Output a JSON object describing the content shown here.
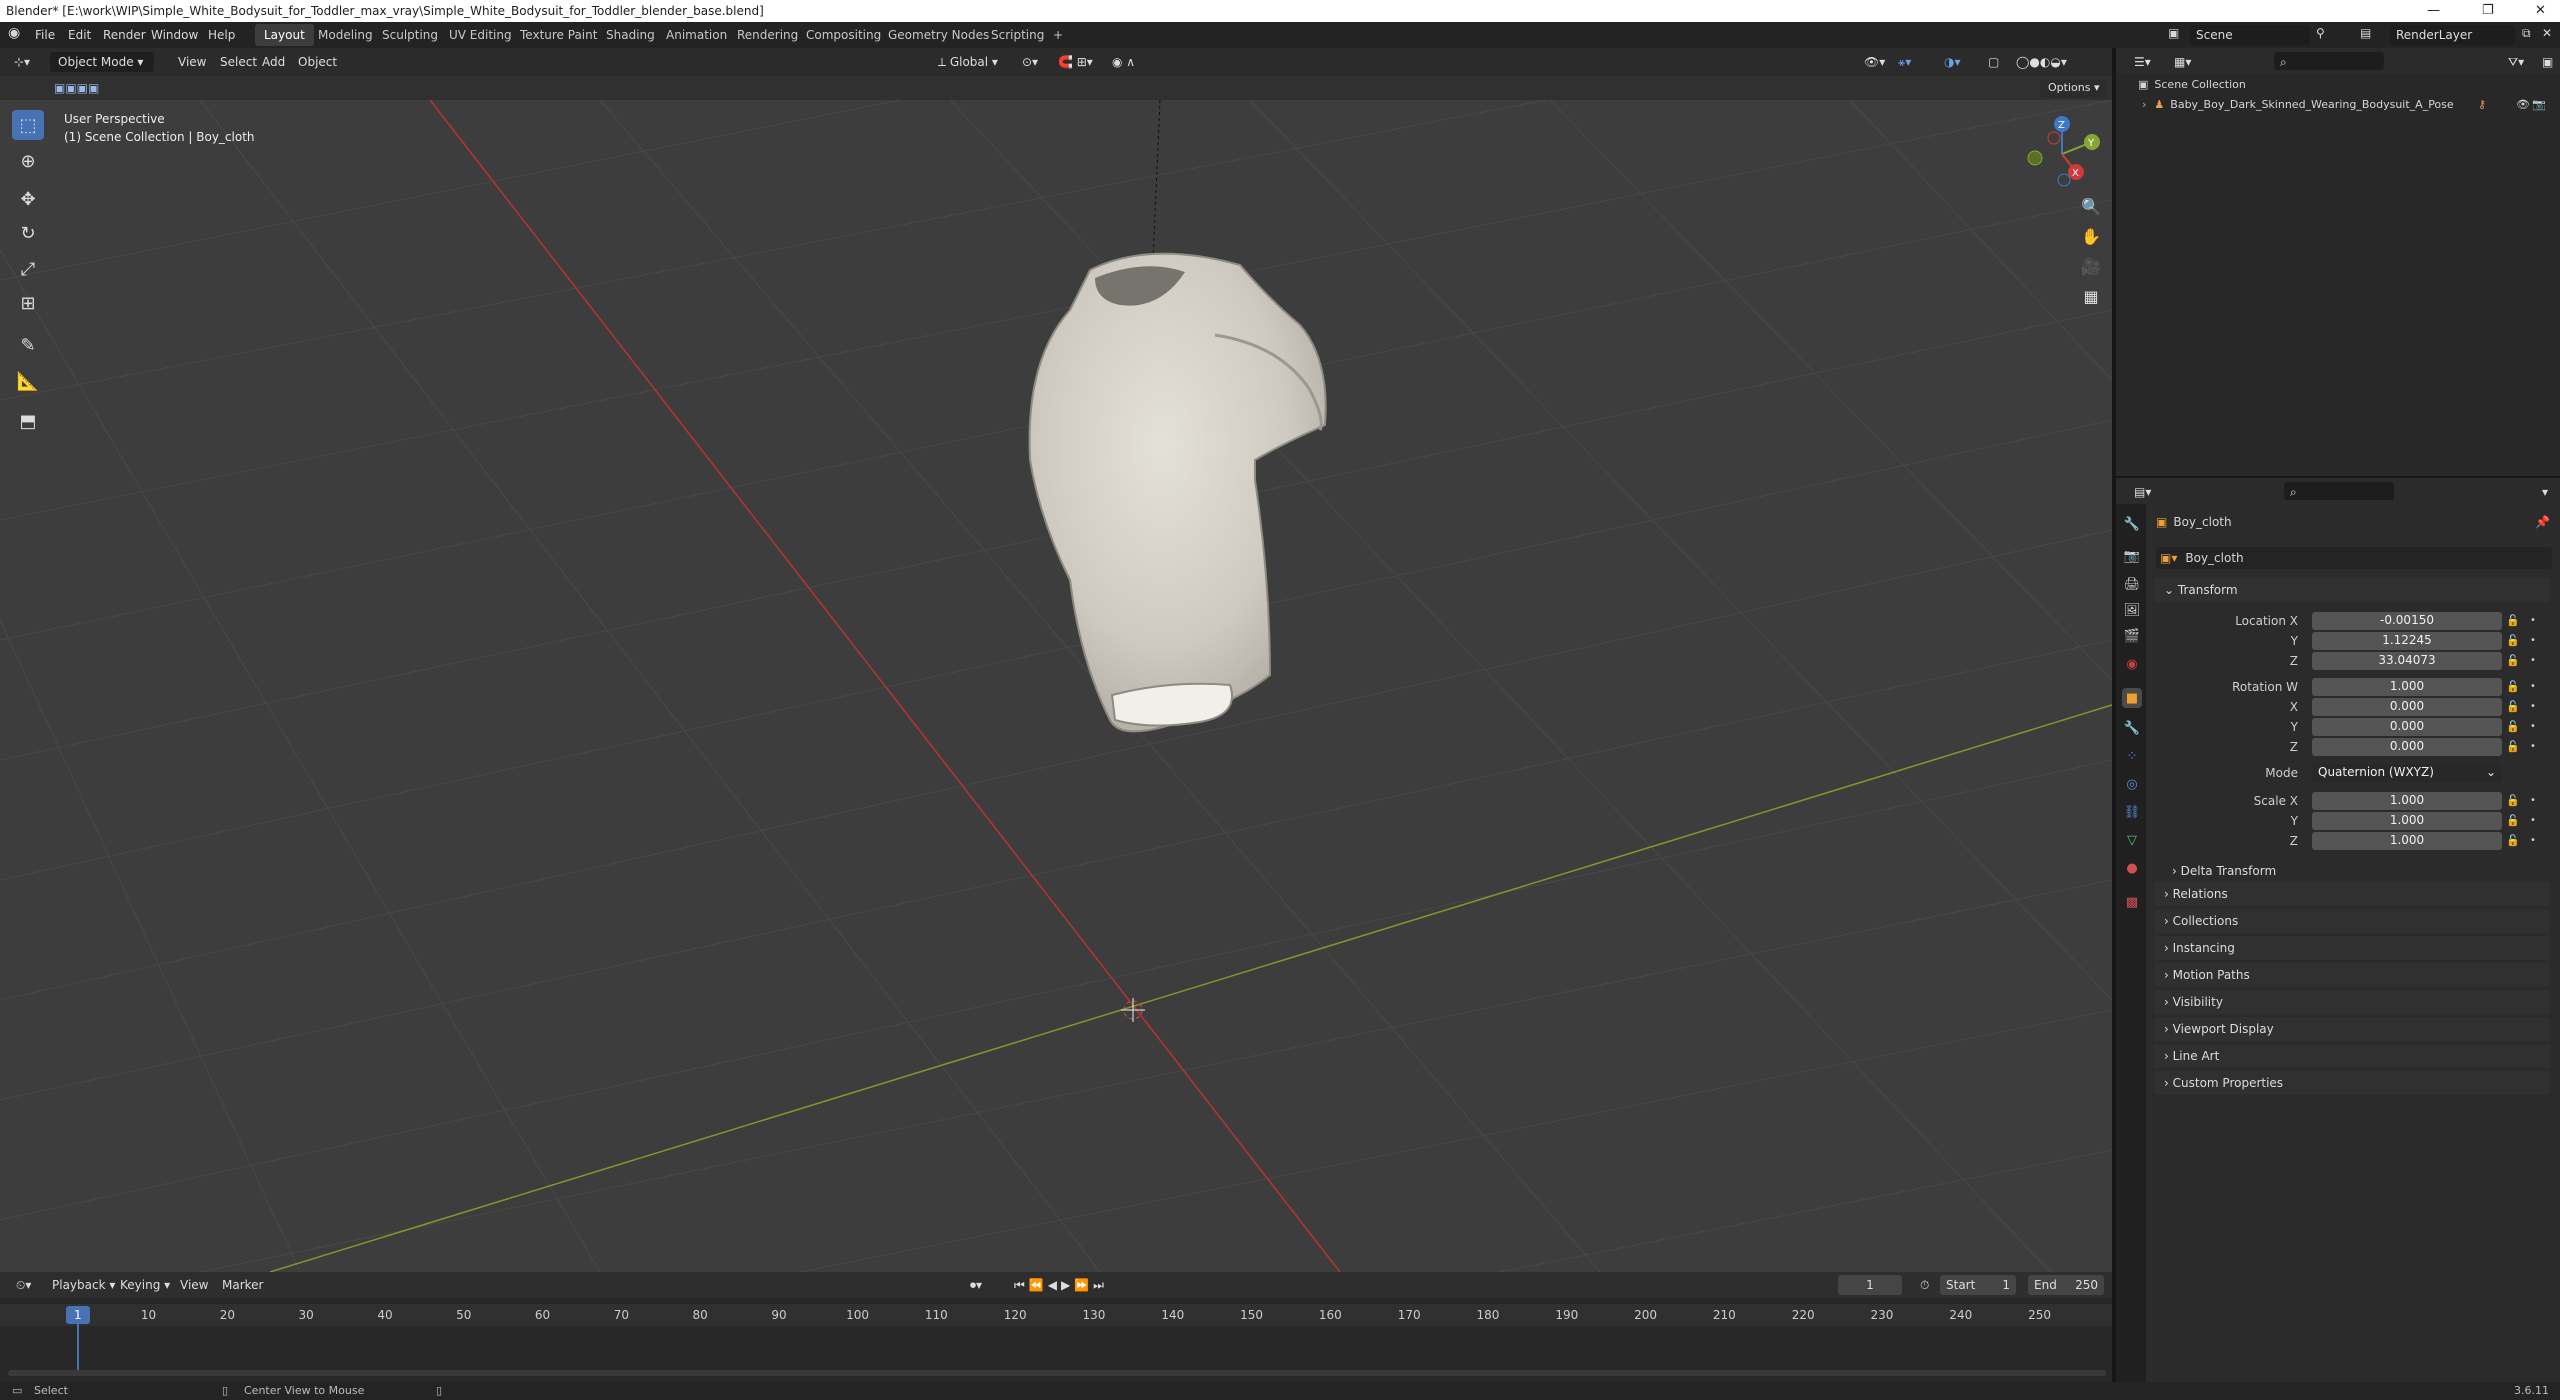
{
  "window": {
    "title": "Blender* [E:\\work\\WIP\\Simple_White_Bodysuit_for_Toddler_max_vray\\Simple_White_Bodysuit_for_Toddler_blender_base.blend]",
    "minimize": "—",
    "maximize": "❐",
    "close": "✕"
  },
  "menu": {
    "file": "File",
    "edit": "Edit",
    "render": "Render",
    "window": "Window",
    "help": "Help"
  },
  "workspaces": [
    "Layout",
    "Modeling",
    "Sculpting",
    "UV Editing",
    "Texture Paint",
    "Shading",
    "Animation",
    "Rendering",
    "Compositing",
    "Geometry Nodes",
    "Scripting",
    "+"
  ],
  "scene": {
    "name": "Scene",
    "render_layer": "RenderLayer"
  },
  "viewport": {
    "mode": "Object Mode",
    "menus": [
      "View",
      "Select",
      "Add",
      "Object"
    ],
    "orientation": "Global",
    "options": "Options",
    "info_line1": "User Perspective",
    "info_line2": "(1) Scene Collection | Boy_cloth",
    "gizmo": {
      "x": "X",
      "y": "Y",
      "z": "Z"
    }
  },
  "outliner": {
    "root": "Scene Collection",
    "item": "Baby_Boy_Dark_Skinned_Wearing_Bodysuit_A_Pose"
  },
  "properties": {
    "object_name": "Boy_cloth",
    "data_name": "Boy_cloth",
    "transform_title": "Transform",
    "location": {
      "label": "Location X",
      "x": "-0.00150",
      "y": "1.12245",
      "z": "33.04073"
    },
    "rotation": {
      "label": "Rotation W",
      "w": "1.000",
      "x": "0.000",
      "y": "0.000",
      "z": "0.000"
    },
    "mode_label": "Mode",
    "mode_value": "Quaternion (WXYZ)",
    "scale": {
      "label": "Scale X",
      "x": "1.000",
      "y": "1.000",
      "z": "1.000"
    },
    "axis_y": "Y",
    "axis_z": "Z",
    "axis_x": "X",
    "delta": "Delta Transform",
    "panels": [
      "Relations",
      "Collections",
      "Instancing",
      "Motion Paths",
      "Visibility",
      "Viewport Display",
      "Line Art",
      "Custom Properties"
    ]
  },
  "timeline": {
    "menus": [
      "Playback",
      "Keying",
      "View",
      "Marker"
    ],
    "current_frame": "1",
    "start_label": "Start",
    "start": "1",
    "end_label": "End",
    "end": "250",
    "ticks": [
      "1",
      "10",
      "20",
      "30",
      "40",
      "50",
      "60",
      "70",
      "80",
      "90",
      "100",
      "110",
      "120",
      "130",
      "140",
      "150",
      "160",
      "170",
      "180",
      "190",
      "200",
      "210",
      "220",
      "230",
      "240",
      "250"
    ]
  },
  "status": {
    "select": "Select",
    "center": "Center View to Mouse",
    "version": "3.6.11"
  },
  "colors": {
    "accent": "#4772b3",
    "x_axis": "#d03a3a",
    "y_axis": "#86a832",
    "z_axis": "#3d78c9"
  }
}
